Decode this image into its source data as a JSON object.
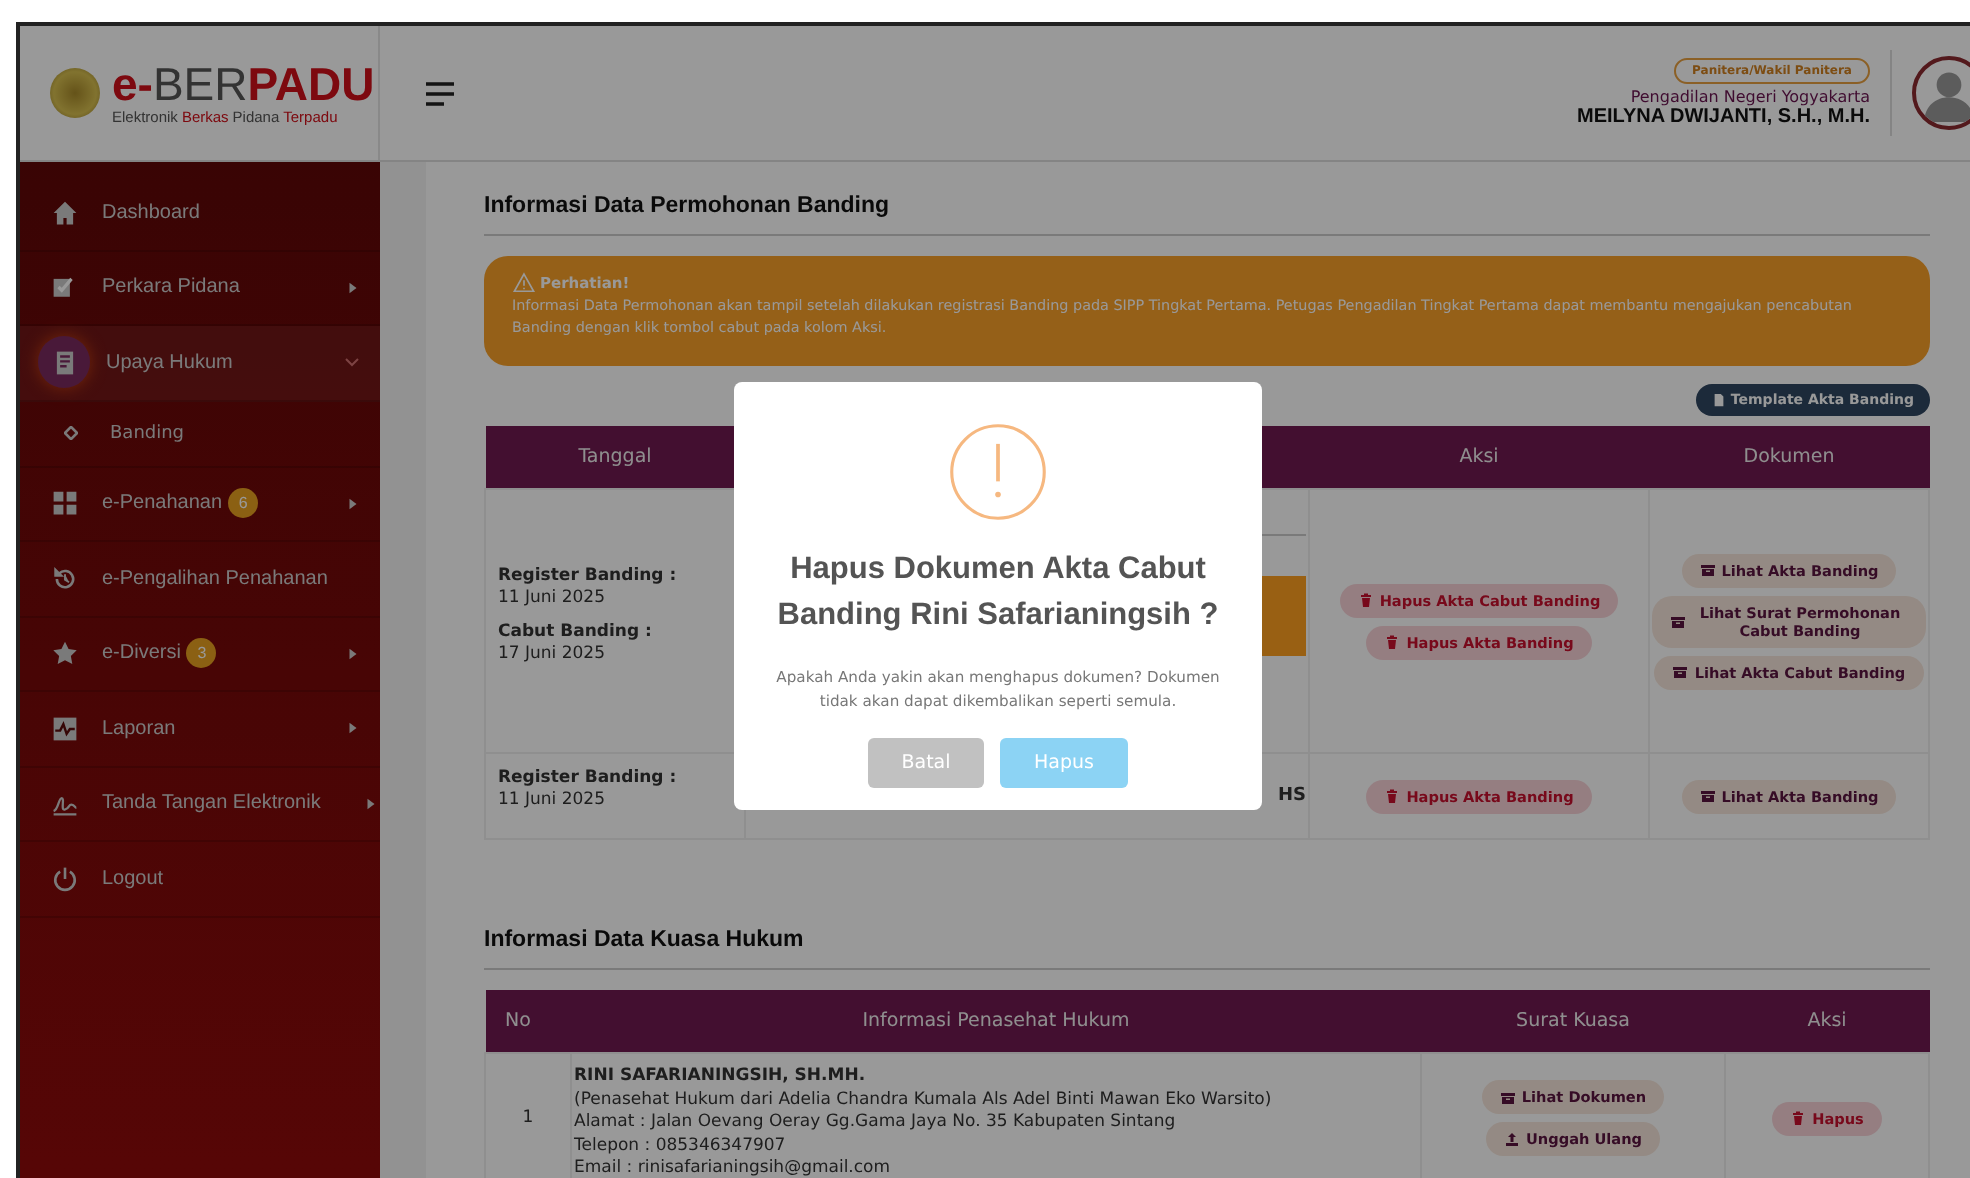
{
  "header": {
    "logo_parts": [
      {
        "text": "e-",
        "accent": true
      },
      {
        "text": "BER",
        "accent": false
      },
      {
        "text": "PADU",
        "accent": true
      }
    ],
    "tagline_parts": [
      {
        "text": "Elektronik",
        "accent": false
      },
      {
        "text": "Berkas",
        "accent": true
      },
      {
        "text": "Pidana",
        "accent": false
      },
      {
        "text": "Terpadu",
        "accent": true
      }
    ],
    "role_badge": "Panitera/Wakil Panitera",
    "court": "Pengadilan Negeri Yogyakarta",
    "user_name": "MEILYNA DWIJANTI, S.H., M.H."
  },
  "sidebar": {
    "items": [
      {
        "label": "Dashboard",
        "submenu": false,
        "selected": false
      },
      {
        "label": "Perkara Pidana",
        "submenu": true,
        "expanded": false,
        "selected": false
      },
      {
        "label": "Upaya Hukum",
        "submenu": true,
        "expanded": true,
        "selected": true,
        "children": [
          {
            "label": "Banding",
            "selected": false
          }
        ]
      },
      {
        "label": "e-Penahanan",
        "badge": "6",
        "submenu": true,
        "expanded": false,
        "selected": false
      },
      {
        "label": "e-Pengalihan Penahanan",
        "submenu": false,
        "selected": false
      },
      {
        "label": "e-Diversi",
        "badge": "3",
        "submenu": true,
        "expanded": false,
        "selected": false
      },
      {
        "label": "Laporan",
        "submenu": true,
        "expanded": false,
        "selected": false
      },
      {
        "label": "Tanda Tangan Elektronik",
        "submenu": true,
        "expanded": false,
        "selected": false
      },
      {
        "label": "Logout",
        "submenu": false,
        "selected": false
      }
    ]
  },
  "banding": {
    "title": "Informasi Data Permohonan Banding",
    "alert": {
      "title": "Perhatian!",
      "text": "Informasi Data Permohonan akan tampil setelah dilakukan registrasi Banding pada SIPP Tingkat Pertama. Petugas Pengadilan Tingkat Pertama dapat membantu mengajukan pencabutan Banding dengan klik tombol cabut pada kolom Aksi."
    },
    "template_button": "Template Akta Banding",
    "columns": [
      "Tanggal",
      "Aksi",
      "Dokumen"
    ],
    "rows": [
      {
        "dates": [
          {
            "label": "Register Banding :",
            "value": "11 Juni 2025"
          },
          {
            "label": "Cabut Banding :",
            "value": "17 Juni 2025"
          }
        ],
        "column_2": {
          "kind": "block"
        },
        "actions": [
          {
            "label": "Hapus Akta Cabut Banding",
            "kind": "delete"
          },
          {
            "label": "Hapus Akta Banding",
            "kind": "delete"
          }
        ],
        "documents": [
          {
            "label": "Lihat Akta Banding",
            "kind": "view"
          },
          {
            "label": "Lihat Surat Permohonan Cabut Banding",
            "kind": "view"
          },
          {
            "label": "Lihat Akta Cabut Banding",
            "kind": "view"
          }
        ]
      },
      {
        "dates": [
          {
            "label": "Register Banding :",
            "value": "11 Juni 2025"
          }
        ],
        "column_2": {
          "kind": "text",
          "text": "HS"
        },
        "actions": [
          {
            "label": "Hapus Akta Banding",
            "kind": "delete"
          }
        ],
        "documents": [
          {
            "label": "Lihat Akta Banding",
            "kind": "view"
          }
        ]
      }
    ]
  },
  "kuasa": {
    "title": "Informasi Data Kuasa Hukum",
    "columns": [
      "No",
      "Informasi Penasehat Hukum",
      "Surat Kuasa",
      "Aksi"
    ],
    "rows": [
      {
        "no": "1",
        "name": "RINI SAFARIANINGSIH, SH.MH.",
        "details": [
          "(Penasehat Hukum dari Adelia Chandra Kumala Als Adel Binti Mawan Eko Warsito)",
          "Alamat : Jalan Oevang Oeray Gg.Gama Jaya No. 35 Kabupaten Sintang",
          "Telepon : 085346347907",
          "Email : rinisafarianingsih@gmail.com"
        ],
        "documents": [
          {
            "label": "Lihat Dokumen",
            "kind": "view"
          },
          {
            "label": "Unggah Ulang",
            "kind": "upload"
          }
        ],
        "actions": [
          {
            "label": "Hapus",
            "kind": "delete"
          }
        ]
      }
    ]
  },
  "modal": {
    "title": "Hapus Dokumen Akta Cabut Banding Rini Safarianingsih ?",
    "message": "Apakah Anda yakin akan menghapus dokumen? Dokumen tidak akan dapat dikembalikan seperti semula.",
    "buttons": [
      {
        "label": "Batal",
        "kind": "cancel"
      },
      {
        "label": "Hapus",
        "kind": "confirm"
      }
    ]
  }
}
